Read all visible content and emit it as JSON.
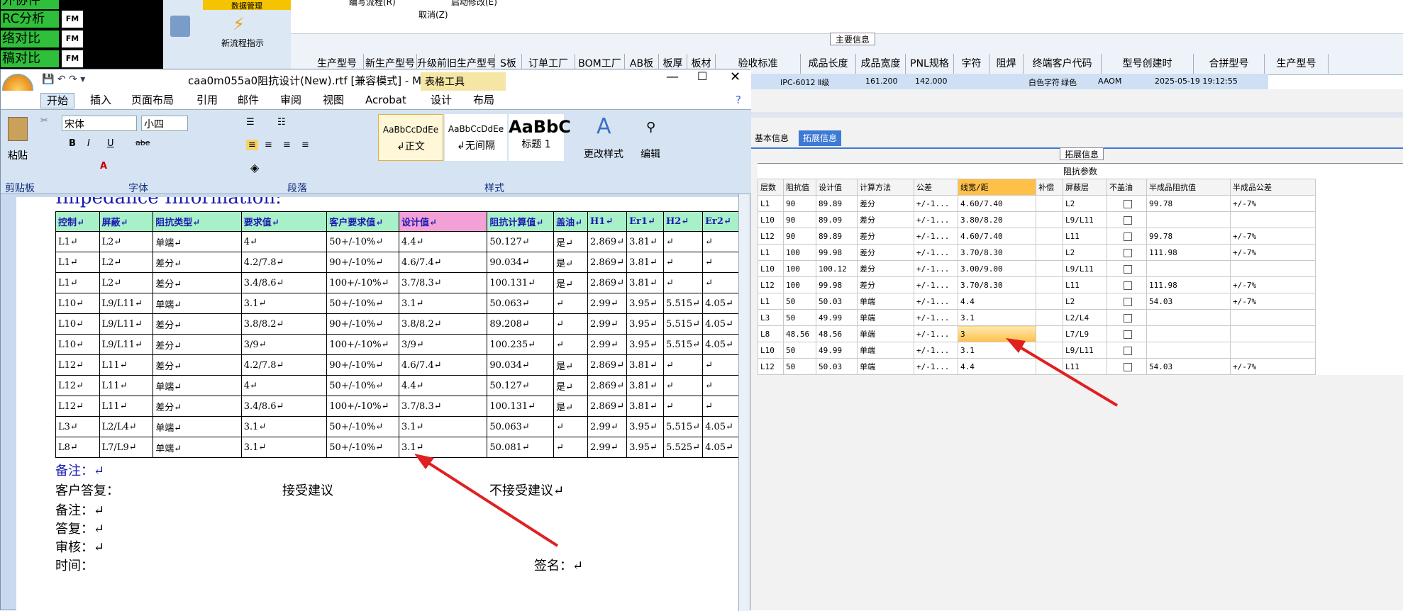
{
  "bg_left": {
    "rows": [
      "外协件",
      "RC分析",
      "络对比",
      "稿对比"
    ],
    "fm": "FM"
  },
  "bg_tool": {
    "menu": "数据管理",
    "new_flow": "新流程指示"
  },
  "bg_top": {
    "t1": "编写流程(R)",
    "t2": "启动修改(E)",
    "t3": "取消(Z)",
    "section": "主要信息"
  },
  "grid": {
    "headers": [
      "生产型号",
      "新生产型号",
      "升级前旧生产型号",
      "S板",
      "订单工厂",
      "BOM工厂",
      "AB板",
      "板厚",
      "板材",
      "验收标准",
      "成品长度",
      "成品宽度",
      "PNL规格",
      "字符",
      "阻焊",
      "终端客户代码",
      "型号创建时",
      "合拼型号",
      "生产型号"
    ],
    "row": {
      "std": "IPC-6012 Ⅱ级",
      "len": "161.200",
      "wid": "142.000",
      "char": "白色字符",
      "mask": "绿色",
      "cust": "AAOM",
      "created": "2025-05-19 19:12:55"
    }
  },
  "right": {
    "tabs": [
      "基本信息",
      "拓展信息"
    ],
    "group_title": "拓展信息",
    "table_title": "阻抗参数",
    "headers": [
      "层数",
      "阻抗值",
      "设计值",
      "计算方法",
      "公差",
      "线宽/距",
      "补偿",
      "屏蔽层",
      "不盖油",
      "半成品阻抗值",
      "半成品公差"
    ],
    "rows": [
      [
        "L1",
        "90",
        "89.89",
        "差分",
        "+/-1...",
        "4.60/7.40",
        "",
        "L2",
        "",
        "99.78",
        "+/-7%"
      ],
      [
        "L10",
        "90",
        "89.09",
        "差分",
        "+/-1...",
        "3.80/8.20",
        "",
        "L9/L11",
        "",
        "",
        ""
      ],
      [
        "L12",
        "90",
        "89.89",
        "差分",
        "+/-1...",
        "4.60/7.40",
        "",
        "L11",
        "",
        "99.78",
        "+/-7%"
      ],
      [
        "L1",
        "100",
        "99.98",
        "差分",
        "+/-1...",
        "3.70/8.30",
        "",
        "L2",
        "",
        "111.98",
        "+/-7%"
      ],
      [
        "L10",
        "100",
        "100.12",
        "差分",
        "+/-1...",
        "3.00/9.00",
        "",
        "L9/L11",
        "",
        "",
        ""
      ],
      [
        "L12",
        "100",
        "99.98",
        "差分",
        "+/-1...",
        "3.70/8.30",
        "",
        "L11",
        "",
        "111.98",
        "+/-7%"
      ],
      [
        "L1",
        "50",
        "50.03",
        "单端",
        "+/-1...",
        "4.4",
        "",
        "L2",
        "",
        "54.03",
        "+/-7%"
      ],
      [
        "L3",
        "50",
        "49.99",
        "单端",
        "+/-1...",
        "3.1",
        "",
        "L2/L4",
        "",
        "",
        ""
      ],
      [
        "L8",
        "48.56",
        "48.56",
        "单端",
        "+/-1...",
        "3",
        "",
        "L7/L9",
        "",
        "",
        ""
      ],
      [
        "L10",
        "50",
        "49.99",
        "单端",
        "+/-1...",
        "3.1",
        "",
        "L9/L11",
        "",
        "",
        ""
      ],
      [
        "L12",
        "50",
        "50.03",
        "单端",
        "+/-1...",
        "4.4",
        "",
        "L11",
        "",
        "54.03",
        "+/-7%"
      ]
    ]
  },
  "word": {
    "title": "caa0m055a0阻抗设计(New).rtf [兼容模式] - M",
    "table_tools": "表格工具",
    "tabs": [
      "开始",
      "插入",
      "页面布局",
      "引用",
      "邮件",
      "审阅",
      "视图",
      "Acrobat",
      "设计",
      "布局"
    ],
    "paste": "粘贴",
    "font": "宋体",
    "size": "小四",
    "groups": [
      "剪贴板",
      "字体",
      "段落",
      "样式"
    ],
    "styles": [
      {
        "sample": "AaBbCcDdEe",
        "name": "↲正文"
      },
      {
        "sample": "AaBbCcDdEe",
        "name": "↲无间隔"
      },
      {
        "sample": "AaBbC",
        "name": "标题 1"
      }
    ],
    "change_style": "更改样式",
    "edit": "编辑",
    "doc_heading": "Impedance Information:",
    "doc_headers": [
      "控制↵",
      "屏蔽↵",
      "阻抗类型↵",
      "要求值↵",
      "客户要求值↵",
      "设计值↵",
      "阻抗计算值↵",
      "盖油↵",
      "H1↵",
      "Er1↵",
      "H2↵",
      "Er2↵"
    ],
    "doc_rows": [
      [
        "L1↵",
        "L2↵",
        "单端↵",
        "4↵",
        "50+/-10%↵",
        "4.4↵",
        "50.127↵",
        "是↵",
        "2.869↵",
        "3.81↵",
        "↵",
        "↵"
      ],
      [
        "L1↵",
        "L2↵",
        "差分↵",
        "4.2/7.8↵",
        "90+/-10%↵",
        "4.6/7.4↵",
        "90.034↵",
        "是↵",
        "2.869↵",
        "3.81↵",
        "↵",
        "↵"
      ],
      [
        "L1↵",
        "L2↵",
        "差分↵",
        "3.4/8.6↵",
        "100+/-10%↵",
        "3.7/8.3↵",
        "100.131↵",
        "是↵",
        "2.869↵",
        "3.81↵",
        "↵",
        "↵"
      ],
      [
        "L10↵",
        "L9/L11↵",
        "单端↵",
        "3.1↵",
        "50+/-10%↵",
        "3.1↵",
        "50.063↵",
        "↵",
        "2.99↵",
        "3.95↵",
        "5.515↵",
        "4.05↵"
      ],
      [
        "L10↵",
        "L9/L11↵",
        "差分↵",
        "3.8/8.2↵",
        "90+/-10%↵",
        "3.8/8.2↵",
        "89.208↵",
        "↵",
        "2.99↵",
        "3.95↵",
        "5.515↵",
        "4.05↵"
      ],
      [
        "L10↵",
        "L9/L11↵",
        "差分↵",
        "3/9↵",
        "100+/-10%↵",
        "3/9↵",
        "100.235↵",
        "↵",
        "2.99↵",
        "3.95↵",
        "5.515↵",
        "4.05↵"
      ],
      [
        "L12↵",
        "L11↵",
        "差分↵",
        "4.2/7.8↵",
        "90+/-10%↵",
        "4.6/7.4↵",
        "90.034↵",
        "是↵",
        "2.869↵",
        "3.81↵",
        "↵",
        "↵"
      ],
      [
        "L12↵",
        "L11↵",
        "单端↵",
        "4↵",
        "50+/-10%↵",
        "4.4↵",
        "50.127↵",
        "是↵",
        "2.869↵",
        "3.81↵",
        "↵",
        "↵"
      ],
      [
        "L12↵",
        "L11↵",
        "差分↵",
        "3.4/8.6↵",
        "100+/-10%↵",
        "3.7/8.3↵",
        "100.131↵",
        "是↵",
        "2.869↵",
        "3.81↵",
        "↵",
        "↵"
      ],
      [
        "L3↵",
        "L2/L4↵",
        "单端↵",
        "3.1↵",
        "50+/-10%↵",
        "3.1↵",
        "50.063↵",
        "↵",
        "2.99↵",
        "3.95↵",
        "5.515↵",
        "4.05↵"
      ],
      [
        "L8↵",
        "L7/L9↵",
        "单端↵",
        "3.1↵",
        "50+/-10%↵",
        "3.1↵",
        "50.081↵",
        "↵",
        "2.99↵",
        "3.95↵",
        "5.525↵",
        "4.05↵"
      ]
    ],
    "note": "备注：↵",
    "reply": "客户答复：",
    "accept": "接受建议",
    "reject": "不接受建议↵",
    "note2": "备注：↵",
    "answer": "答复：↵",
    "review": "审核：↵",
    "time": "时间：",
    "sign": "签名：↵"
  },
  "colors": {
    "arrow": "#e02020",
    "highlight": "#ffc04a"
  }
}
